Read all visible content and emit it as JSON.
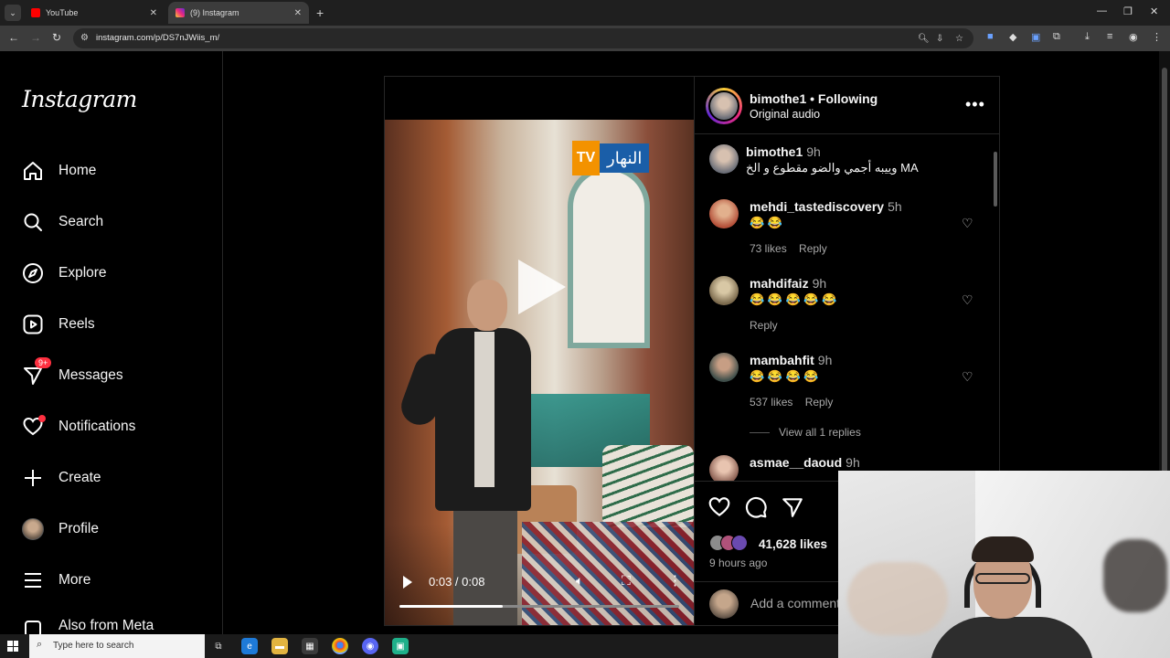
{
  "browser": {
    "tabs": [
      {
        "title": "YouTube",
        "active": false,
        "favicon_color": "#ff0000"
      },
      {
        "title": "(9) Instagram",
        "active": true,
        "favicon_color": "#e1306c"
      }
    ],
    "url": "instagram.com/p/DS7nJWiis_m/"
  },
  "sidebar": {
    "logo": "Instagram",
    "items": [
      {
        "label": "Home",
        "icon": "home-icon"
      },
      {
        "label": "Search",
        "icon": "search-icon"
      },
      {
        "label": "Explore",
        "icon": "compass-icon"
      },
      {
        "label": "Reels",
        "icon": "reels-icon"
      },
      {
        "label": "Messages",
        "icon": "messenger-icon",
        "badge": "9+"
      },
      {
        "label": "Notifications",
        "icon": "heart-icon"
      },
      {
        "label": "Create",
        "icon": "plus-icon"
      },
      {
        "label": "Profile",
        "icon": "avatar"
      },
      {
        "label": "More",
        "icon": "menu-icon"
      },
      {
        "label": "Also from Meta",
        "icon": "meta-icon"
      }
    ]
  },
  "post": {
    "author": "bimothe1",
    "follow_status": "• Following",
    "audio": "Original audio",
    "video": {
      "channel_logo_tv": "TV",
      "channel_logo_name": "النهار",
      "time": "0:03 / 0:08",
      "progress": 0.37
    },
    "comments": [
      {
        "user": "bimothe1",
        "time": "9h",
        "text": "وييبه أجمي والضو مقطوع و الخ MA",
        "likes": "",
        "reply": ""
      },
      {
        "user": "mehdi_tastediscovery",
        "time": "5h",
        "text": "😂 😂",
        "likes": "73 likes",
        "reply": "Reply"
      },
      {
        "user": "mahdifaiz",
        "time": "9h",
        "text": "😂 😂 😂 😂 😂",
        "likes": "",
        "reply": "Reply"
      },
      {
        "user": "mambahfit",
        "time": "9h",
        "text": "😂 😂 😂 😂",
        "likes": "537 likes",
        "reply": "Reply"
      },
      {
        "user": "asmae__daoud",
        "time": "9h",
        "text": "",
        "likes": "",
        "reply": ""
      }
    ],
    "view_replies": "View all 1 replies",
    "likes_count": "41,628 likes",
    "posted": "9 hours ago",
    "add_comment_placeholder": "Add a comment..."
  },
  "taskbar": {
    "search_placeholder": "Type here to search"
  },
  "colors": {
    "background": "#000000",
    "notification_red": "#ff3040",
    "secondary_text": "#a8a8a8"
  }
}
